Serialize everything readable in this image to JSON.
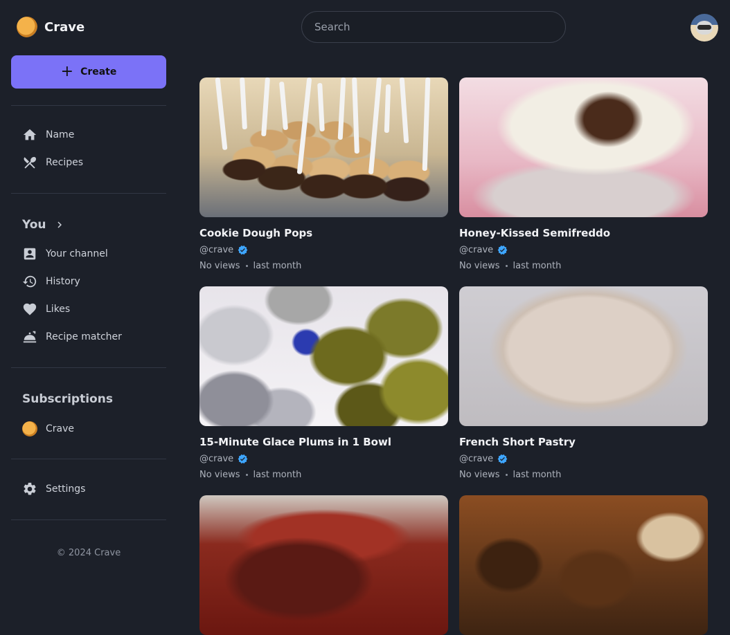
{
  "app": {
    "name": "Crave"
  },
  "search": {
    "placeholder": "Search"
  },
  "sidebar": {
    "create_label": "Create",
    "primary": [
      {
        "label": "Name",
        "icon": "home-icon"
      },
      {
        "label": "Recipes",
        "icon": "utensils-icon"
      }
    ],
    "you": {
      "title": "You",
      "items": [
        {
          "label": "Your channel",
          "icon": "account-box-icon"
        },
        {
          "label": "History",
          "icon": "history-icon"
        },
        {
          "label": "Likes",
          "icon": "heart-icon"
        },
        {
          "label": "Recipe matcher",
          "icon": "food-tray-icon"
        }
      ]
    },
    "subscriptions": {
      "title": "Subscriptions",
      "items": [
        {
          "label": "Crave"
        }
      ]
    },
    "settings_label": "Settings",
    "footer": "© 2024 Crave"
  },
  "colors": {
    "accent": "#7b72f7",
    "verified": "#3ea6ff",
    "background": "#1c2029"
  },
  "videos": [
    {
      "title": "Cookie Dough Pops",
      "channel": "@crave",
      "views": "No views",
      "age": "last month"
    },
    {
      "title": "Honey-Kissed Semifreddo",
      "channel": "@crave",
      "views": "No views",
      "age": "last month"
    },
    {
      "title": "15-Minute Glace Plums in 1 Bowl",
      "channel": "@crave",
      "views": "No views",
      "age": "last month"
    },
    {
      "title": "French Short Pastry",
      "channel": "@crave",
      "views": "No views",
      "age": "last month"
    }
  ]
}
